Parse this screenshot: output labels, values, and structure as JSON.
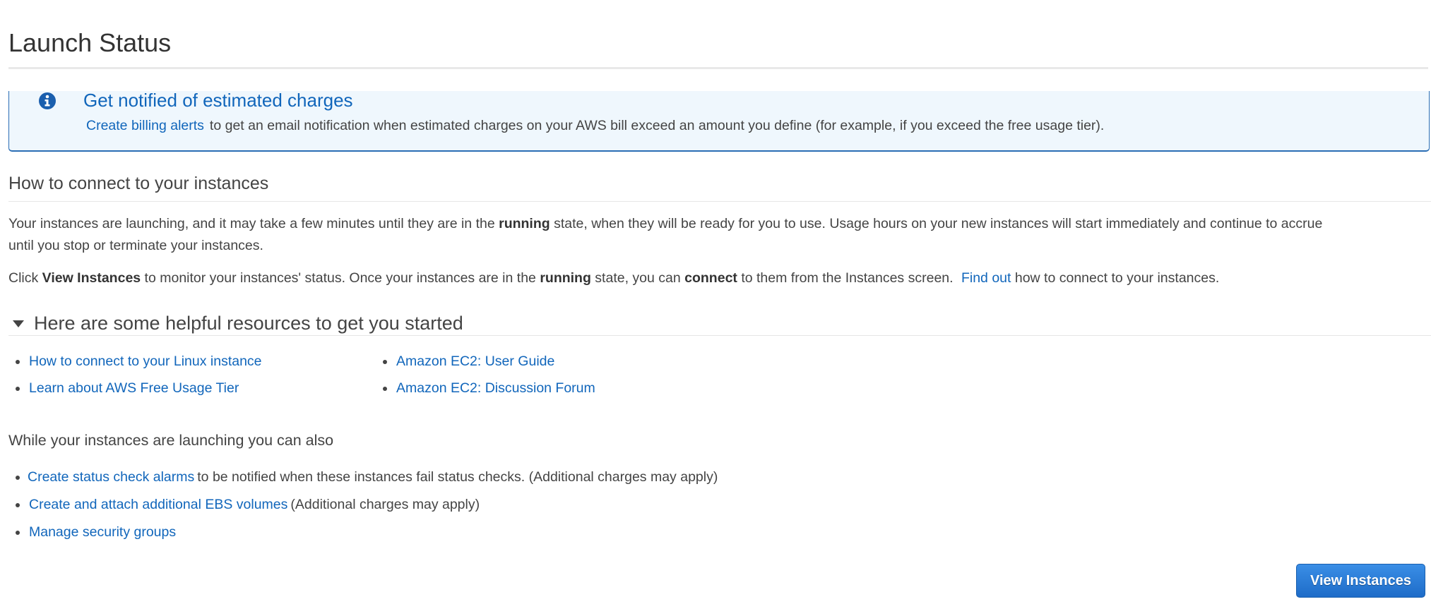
{
  "page": {
    "title": "Launch Status"
  },
  "billing_banner": {
    "icon": "info-circle-icon",
    "title": "Get notified of estimated charges",
    "link_label": "Create billing alerts",
    "text": "to get an email notification when estimated charges on your AWS bill exceed an amount you define (for example, if you exceed the free usage tier).",
    "accent_color": "#1166bb"
  },
  "connect_section": {
    "heading": "How to connect to your instances",
    "para1": {
      "part1": "Your instances are launching, and it may take a few minutes until they are in the ",
      "bold1": "running",
      "part2": " state, when they will be ready for you to use. Usage hours on your new instances will start immediately and continue to accrue",
      "line2": "until you stop or terminate your instances."
    },
    "para2": {
      "part1": "Click ",
      "bold1": "View Instances",
      "part2": " to monitor your instances' status. Once your instances are in the ",
      "bold2": "running",
      "part3": " state, you can ",
      "bold3": "connect",
      "part4": " to them from the Instances screen. ",
      "link_label": "Find out",
      "part5": " how to connect to your instances."
    }
  },
  "resources_section": {
    "heading": "Here are some helpful resources to get you started",
    "expanded": true,
    "links_col1": [
      "How to connect to your Linux instance",
      "Learn about AWS Free Usage Tier"
    ],
    "links_col2": [
      "Amazon EC2: User Guide",
      "Amazon EC2: Discussion Forum"
    ]
  },
  "also_section": {
    "heading": "While your instances are launching you can also",
    "items": [
      {
        "link": "Create status check alarms",
        "text": " to be notified when these instances fail status checks. (Additional charges may apply)"
      },
      {
        "link": "Create and attach additional EBS volumes",
        "text": " (Additional charges may apply)"
      },
      {
        "link": "Manage security groups",
        "text": ""
      }
    ]
  },
  "actions": {
    "view_instances_label": "View Instances",
    "button_color": "#1e6cc8"
  }
}
